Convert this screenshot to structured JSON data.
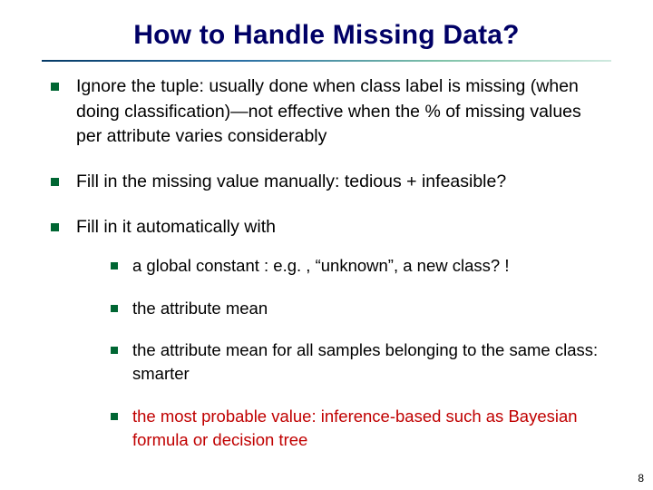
{
  "title": "How to Handle Missing Data?",
  "bullets": [
    {
      "text": "Ignore the tuple: usually done when class label is missing (when doing classification)—not effective when the % of missing values per attribute varies considerably"
    },
    {
      "text": "Fill in the missing value manually: tedious + infeasible?"
    },
    {
      "text": "Fill in it automatically with",
      "sub": [
        "a global constant : e.g. , “unknown”, a new class? !",
        "the attribute mean",
        "the attribute mean for all samples belonging to the same class: smarter",
        "the most probable value: inference-based such as Bayesian formula or decision tree"
      ]
    }
  ],
  "page_number": "8",
  "colors": {
    "title": "#000066",
    "bullet_marker": "#006633",
    "highlight": "#c00000"
  }
}
